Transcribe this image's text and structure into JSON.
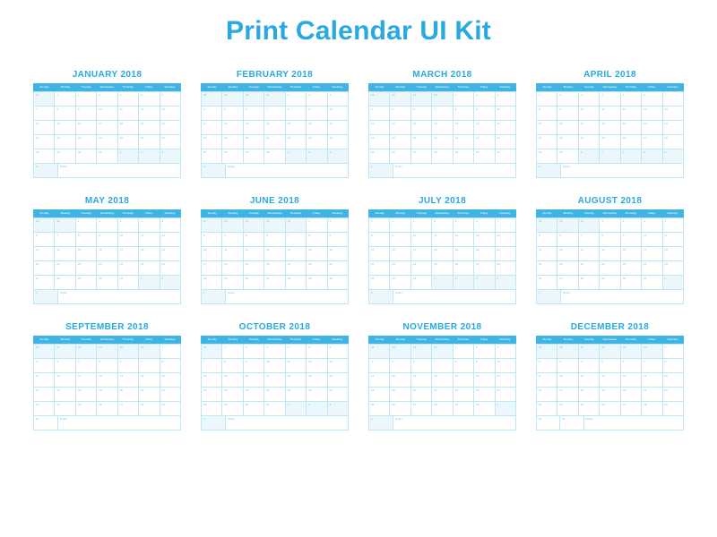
{
  "title": "Print Calendar UI Kit",
  "year": 2018,
  "days_of_week": [
    "Sunday",
    "Monday",
    "Tuesday",
    "Wednesday",
    "Thursday",
    "Friday",
    "Saturday"
  ],
  "notes_label": "Notes",
  "accent_color": "#29a9e0",
  "grid_line_color": "#bfe6f6",
  "shade_color": "#ecf7fc",
  "months": [
    {
      "name": "JANUARY 2018",
      "first_dow": 1,
      "days": 31,
      "prev_days": 31
    },
    {
      "name": "FEBRUARY 2018",
      "first_dow": 4,
      "days": 28,
      "prev_days": 31
    },
    {
      "name": "MARCH 2018",
      "first_dow": 4,
      "days": 31,
      "prev_days": 28
    },
    {
      "name": "APRIL 2018",
      "first_dow": 0,
      "days": 30,
      "prev_days": 31
    },
    {
      "name": "MAY 2018",
      "first_dow": 2,
      "days": 31,
      "prev_days": 30
    },
    {
      "name": "JUNE 2018",
      "first_dow": 5,
      "days": 30,
      "prev_days": 31
    },
    {
      "name": "JULY 2018",
      "first_dow": 0,
      "days": 31,
      "prev_days": 30
    },
    {
      "name": "AUGUST 2018",
      "first_dow": 3,
      "days": 31,
      "prev_days": 31
    },
    {
      "name": "SEPTEMBER 2018",
      "first_dow": 6,
      "days": 30,
      "prev_days": 31
    },
    {
      "name": "OCTOBER 2018",
      "first_dow": 1,
      "days": 31,
      "prev_days": 30
    },
    {
      "name": "NOVEMBER 2018",
      "first_dow": 4,
      "days": 30,
      "prev_days": 31
    },
    {
      "name": "DECEMBER 2018",
      "first_dow": 6,
      "days": 31,
      "prev_days": 30
    }
  ]
}
